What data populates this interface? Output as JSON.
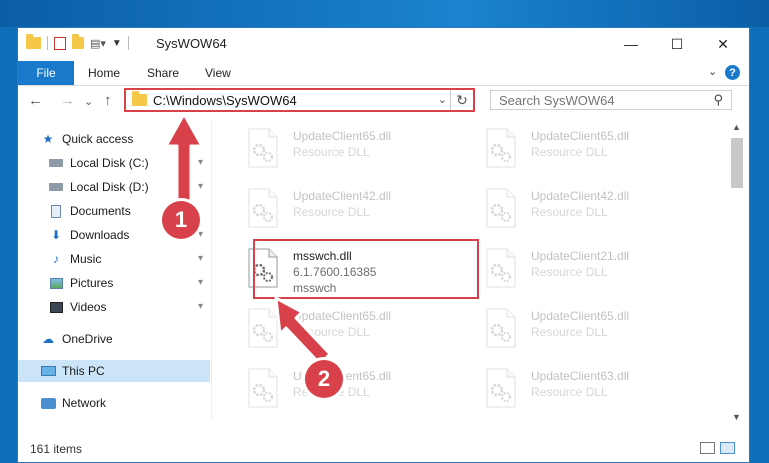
{
  "window": {
    "title": "SysWOW64",
    "controls": {
      "minimize": "—",
      "maximize": "☐",
      "close": "✕"
    }
  },
  "ribbon": {
    "file": "File",
    "home": "Home",
    "share": "Share",
    "view": "View",
    "expand": "⌄",
    "help": "?"
  },
  "nav": {
    "back": "←",
    "forward": "→",
    "recent": "⌄",
    "up": "↑",
    "address": "C:\\Windows\\SysWOW64",
    "address_dropdown": "⌄",
    "refresh": "↻",
    "search_placeholder": "Search SysWOW64",
    "search_icon": "⚲"
  },
  "sidebar": {
    "items": [
      {
        "label": "Quick access",
        "icon": "star-icon",
        "pinned": false
      },
      {
        "label": "Local Disk (C:)",
        "icon": "drive-icon",
        "pinned": true
      },
      {
        "label": "Local Disk (D:)",
        "icon": "drive-icon",
        "pinned": true
      },
      {
        "label": "Documents",
        "icon": "documents-icon",
        "pinned": true
      },
      {
        "label": "Downloads",
        "icon": "download-icon",
        "pinned": true
      },
      {
        "label": "Music",
        "icon": "music-icon",
        "pinned": true
      },
      {
        "label": "Pictures",
        "icon": "pictures-icon",
        "pinned": true
      },
      {
        "label": "Videos",
        "icon": "videos-icon",
        "pinned": true
      },
      {
        "label": "OneDrive",
        "icon": "cloud-icon",
        "pinned": false
      },
      {
        "label": "This PC",
        "icon": "computer-icon",
        "pinned": false
      },
      {
        "label": "Network",
        "icon": "network-icon",
        "pinned": false
      }
    ],
    "pin_glyph": "📌"
  },
  "files": [
    {
      "name": "UpdateClient65.dll",
      "desc": "Resource DLL",
      "faded": true
    },
    {
      "name": "UpdateClient65.dll",
      "desc": "Resource DLL",
      "faded": true
    },
    {
      "name": "UpdateClient42.dll",
      "desc": "Resource DLL",
      "faded": true
    },
    {
      "name": "UpdateClient42.dll",
      "desc": "Resource DLL",
      "faded": true
    },
    {
      "name": "msswch.dll",
      "desc": "6.1.7600.16385",
      "sub": "msswch",
      "faded": false
    },
    {
      "name": "UpdateClient21.dll",
      "desc": "Resource DLL",
      "faded": true
    },
    {
      "name": "UpdateClient65.dll",
      "desc": "Resource DLL",
      "faded": true
    },
    {
      "name": "UpdateClient65.dll",
      "desc": "Resource DLL",
      "faded": true
    },
    {
      "name": "UpdateClient65.dll",
      "desc": "Resource DLL",
      "faded": true
    },
    {
      "name": "UpdateClient63.dll",
      "desc": "Resource DLL",
      "faded": true
    }
  ],
  "status": {
    "count": "161 items"
  },
  "annotations": {
    "step1": "1",
    "step2": "2",
    "color": "#d9414a"
  }
}
